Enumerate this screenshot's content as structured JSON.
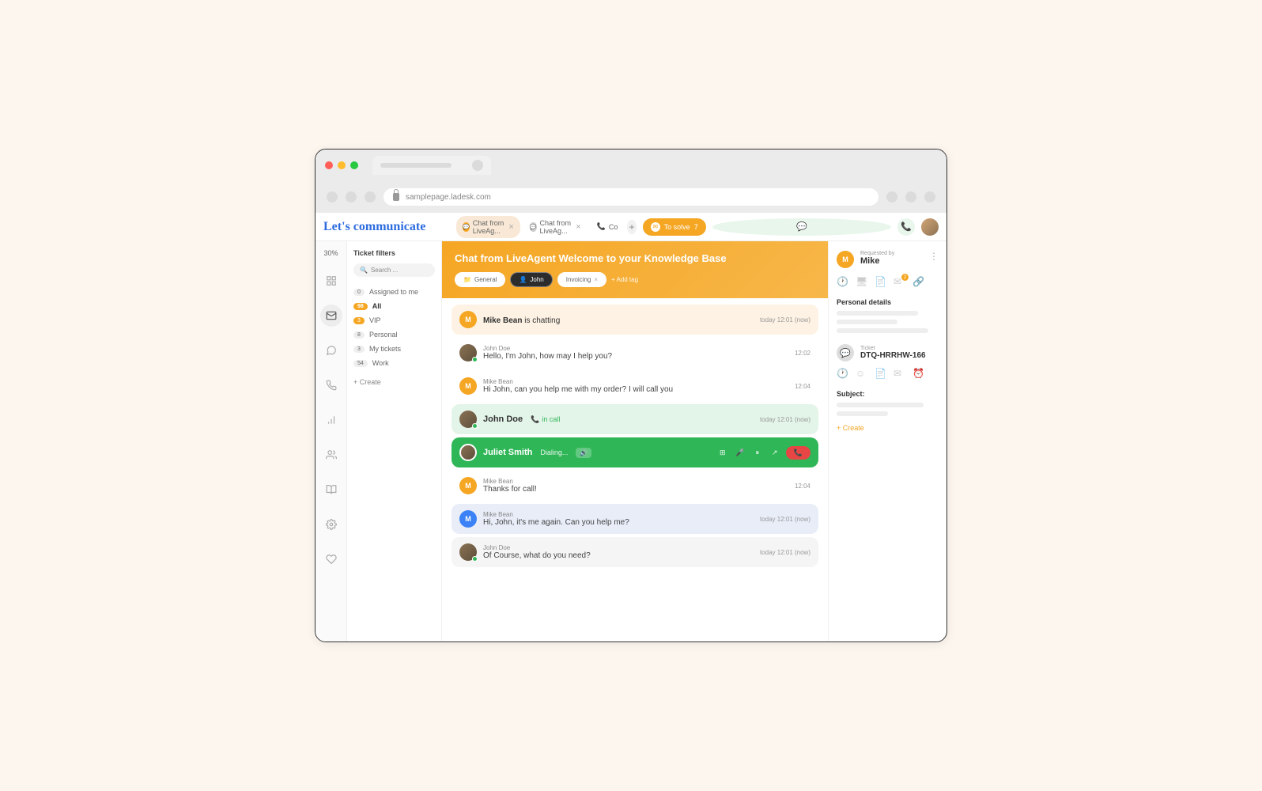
{
  "url": "samplepage.ladesk.com",
  "brand": "Let's communicate",
  "header": {
    "tabs": [
      {
        "label": "Chat from LiveAg..."
      },
      {
        "label": "Chat from LiveAg..."
      },
      {
        "label": "Co"
      }
    ],
    "tosolve_label": "To solve",
    "tosolve_count": "7"
  },
  "sidebar": {
    "usage": "30%"
  },
  "filters": {
    "title": "Ticket filters",
    "search_placeholder": "Search ...",
    "items": [
      {
        "count": "0",
        "label": "Assigned to me"
      },
      {
        "count": "98",
        "label": "All"
      },
      {
        "count": "3",
        "label": "VIP"
      },
      {
        "count": "8",
        "label": "Personal"
      },
      {
        "count": "3",
        "label": "My tickets"
      },
      {
        "count": "54",
        "label": "Work"
      }
    ],
    "create": "Create"
  },
  "hero": {
    "title": "Chat from LiveAgent Welcome to your Knowledge Base",
    "tag_general": "General",
    "tag_john": "John",
    "tag_invoicing": "Invoicing",
    "add_tag": "Add tag"
  },
  "messages": [
    {
      "type": "cream",
      "avatar": "M",
      "name": "Mike Bean",
      "text": "is chatting",
      "time": "today 12:01 (now)"
    },
    {
      "type": "plain",
      "avatar": "photo",
      "name": "John Doe",
      "text": "Hello, I'm John, how may I help you?",
      "time": "12:02"
    },
    {
      "type": "plain",
      "avatar": "M",
      "avclass": "orange",
      "name": "Mike Bean",
      "text": "Hi John, can you help me with my order? I will call you",
      "time": "12:04"
    },
    {
      "type": "green",
      "avatar": "photo",
      "name": "John Doe",
      "status": "in call",
      "time": "today 12:01 (now)"
    },
    {
      "type": "greendk",
      "avatar": "photo",
      "name": "Juliet Smith",
      "status": "Dialing..."
    },
    {
      "type": "plain",
      "avatar": "M",
      "avclass": "orange",
      "name": "Mike Bean",
      "text": "Thanks for call!",
      "time": "12:04"
    },
    {
      "type": "blue",
      "avatar": "M",
      "avclass": "blue",
      "name": "Mike Bean",
      "text": "Hi, John, it's me again. Can you help me?",
      "time": "today 12:01 (now)"
    },
    {
      "type": "gray",
      "avatar": "photo",
      "name": "John Doe",
      "text": "Of Course, what do you need?",
      "time": "today 12:01 (now)"
    }
  ],
  "details": {
    "requested_by_label": "Requested by",
    "requested_by_name": "Mike",
    "personal_label": "Personal details",
    "ticket_label": "Ticket",
    "ticket_id": "DTQ-HRRHW-166",
    "subject_label": "Subject:",
    "create": "Create",
    "notif_count": "2"
  }
}
